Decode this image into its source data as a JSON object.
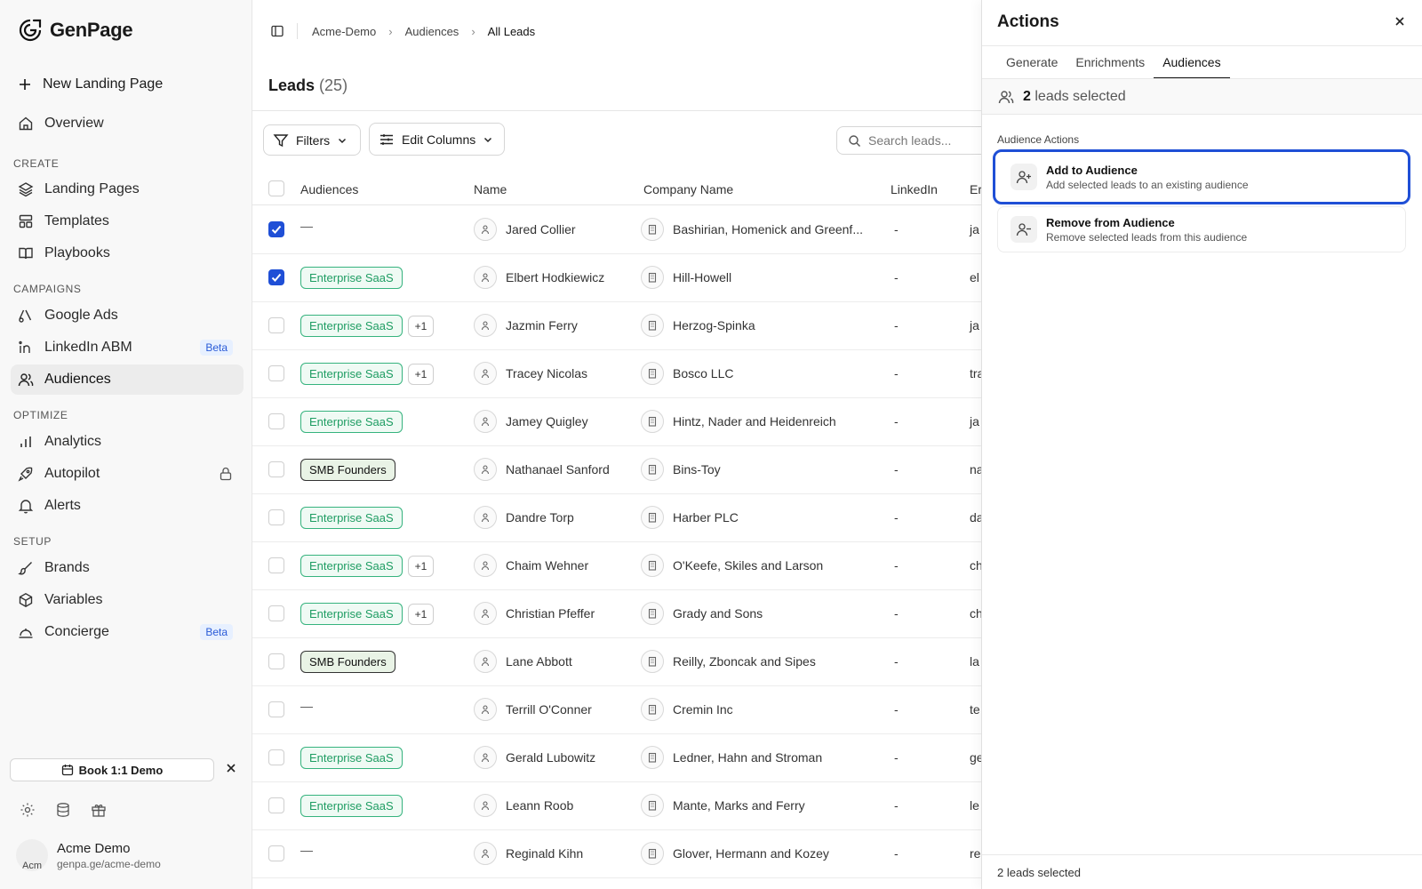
{
  "app": {
    "name": "GenPage"
  },
  "sidebar": {
    "new_landing_page": "New Landing Page",
    "overview": "Overview",
    "sections": {
      "create": "CREATE",
      "campaigns": "CAMPAIGNS",
      "optimize": "OPTIMIZE",
      "setup": "SETUP"
    },
    "items": {
      "landing_pages": "Landing Pages",
      "templates": "Templates",
      "playbooks": "Playbooks",
      "google_ads": "Google Ads",
      "linkedin_abm": "LinkedIn ABM",
      "audiences": "Audiences",
      "analytics": "Analytics",
      "autopilot": "Autopilot",
      "alerts": "Alerts",
      "brands": "Brands",
      "variables": "Variables",
      "concierge": "Concierge"
    },
    "beta_badge": "Beta",
    "book_demo": "Book 1:1 Demo",
    "user": {
      "name": "Acme Demo",
      "url": "genpa.ge/acme-demo",
      "avatar_alt": "Acm"
    }
  },
  "breadcrumb": [
    "Acme-Demo",
    "Audiences",
    "All Leads"
  ],
  "page": {
    "title": "Leads",
    "count": "(25)"
  },
  "toolbar": {
    "filters": "Filters",
    "edit_columns": "Edit Columns",
    "search_placeholder": "Search leads..."
  },
  "table": {
    "columns": {
      "audiences": "Audiences",
      "name": "Name",
      "company": "Company Name",
      "linkedin": "LinkedIn",
      "email": "Er"
    },
    "rows": [
      {
        "checked": true,
        "tag": "",
        "plus": "",
        "name": "Jared Collier",
        "company": "Bashirian, Homenick and Greenf...",
        "linkedin": "-",
        "email": "ja"
      },
      {
        "checked": true,
        "tag": "Enterprise SaaS",
        "plus": "",
        "name": "Elbert Hodkiewicz",
        "company": "Hill-Howell",
        "linkedin": "-",
        "email": "el"
      },
      {
        "checked": false,
        "tag": "Enterprise SaaS",
        "plus": "+1",
        "name": "Jazmin Ferry",
        "company": "Herzog-Spinka",
        "linkedin": "-",
        "email": "ja"
      },
      {
        "checked": false,
        "tag": "Enterprise SaaS",
        "plus": "+1",
        "name": "Tracey Nicolas",
        "company": "Bosco LLC",
        "linkedin": "-",
        "email": "tra"
      },
      {
        "checked": false,
        "tag": "Enterprise SaaS",
        "plus": "",
        "name": "Jamey Quigley",
        "company": "Hintz, Nader and Heidenreich",
        "linkedin": "-",
        "email": "ja"
      },
      {
        "checked": false,
        "tag": "SMB Founders",
        "plus": "",
        "name": "Nathanael Sanford",
        "company": "Bins-Toy",
        "linkedin": "-",
        "email": "na"
      },
      {
        "checked": false,
        "tag": "Enterprise SaaS",
        "plus": "",
        "name": "Dandre Torp",
        "company": "Harber PLC",
        "linkedin": "-",
        "email": "da"
      },
      {
        "checked": false,
        "tag": "Enterprise SaaS",
        "plus": "+1",
        "name": "Chaim Wehner",
        "company": "O'Keefe, Skiles and Larson",
        "linkedin": "-",
        "email": "ch"
      },
      {
        "checked": false,
        "tag": "Enterprise SaaS",
        "plus": "+1",
        "name": "Christian Pfeffer",
        "company": "Grady and Sons",
        "linkedin": "-",
        "email": "ch"
      },
      {
        "checked": false,
        "tag": "SMB Founders",
        "plus": "",
        "name": "Lane Abbott",
        "company": "Reilly, Zboncak and Sipes",
        "linkedin": "-",
        "email": "la"
      },
      {
        "checked": false,
        "tag": "",
        "plus": "",
        "name": "Terrill O'Conner",
        "company": "Cremin Inc",
        "linkedin": "-",
        "email": "te"
      },
      {
        "checked": false,
        "tag": "Enterprise SaaS",
        "plus": "",
        "name": "Gerald Lubowitz",
        "company": "Ledner, Hahn and Stroman",
        "linkedin": "-",
        "email": "ge"
      },
      {
        "checked": false,
        "tag": "Enterprise SaaS",
        "plus": "",
        "name": "Leann Roob",
        "company": "Mante, Marks and Ferry",
        "linkedin": "-",
        "email": "le"
      },
      {
        "checked": false,
        "tag": "",
        "plus": "",
        "name": "Reginald Kihn",
        "company": "Glover, Hermann and Kozey",
        "linkedin": "-",
        "email": "re"
      }
    ],
    "empty_tag": "—"
  },
  "panel": {
    "title": "Actions",
    "tabs": [
      "Generate",
      "Enrichments",
      "Audiences"
    ],
    "active_tab": "Audiences",
    "selected_count": "2",
    "selected_text": "leads selected",
    "section_label": "Audience Actions",
    "actions": [
      {
        "title": "Add to Audience",
        "subtitle": "Add selected leads to an existing audience"
      },
      {
        "title": "Remove from Audience",
        "subtitle": "Remove selected leads from this audience"
      }
    ],
    "footer": "2 leads selected"
  },
  "colors": {
    "accent": "#1f4fd6",
    "tag_green": "#1f9d63",
    "beta_blue": "#2a5bd7"
  }
}
